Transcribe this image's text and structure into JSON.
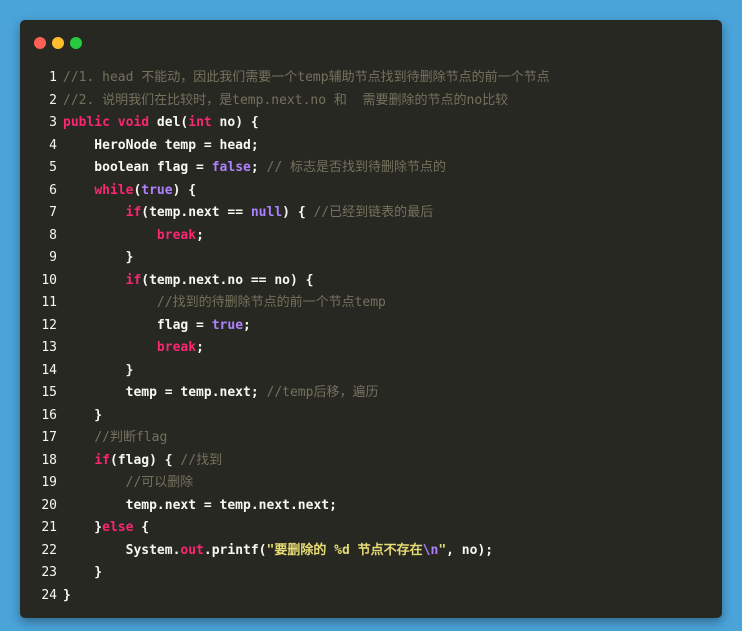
{
  "window": {
    "controls": [
      "close",
      "minimize",
      "maximize"
    ],
    "colors": {
      "close": "#ff5f56",
      "minimize": "#ffbd2e",
      "maximize": "#27c93f",
      "background": "#272822"
    }
  },
  "code_lines": [
    {
      "num": "1",
      "segs": [
        [
          "c-com",
          "//1. head 不能动，因此我们需要一个temp辅助节点找到待删除节点的前一个节点"
        ]
      ]
    },
    {
      "num": "2",
      "segs": [
        [
          "c-com",
          "//2. 说明我们在比较时，是temp.next.no 和  需要删除的节点的no比较"
        ]
      ]
    },
    {
      "num": "3",
      "segs": [
        [
          "c-kw",
          "public"
        ],
        [
          "",
          " "
        ],
        [
          "c-kw",
          "void"
        ],
        [
          "",
          " del("
        ],
        [
          "c-kw",
          "int"
        ],
        [
          "",
          " no) {"
        ]
      ]
    },
    {
      "num": "4",
      "segs": [
        [
          "",
          "    HeroNode temp = head;"
        ]
      ]
    },
    {
      "num": "5",
      "segs": [
        [
          "",
          "    boolean flag = "
        ],
        [
          "c-const",
          "false"
        ],
        [
          "",
          "; "
        ],
        [
          "c-com",
          "// 标志是否找到待删除节点的"
        ]
      ]
    },
    {
      "num": "6",
      "segs": [
        [
          "",
          "    "
        ],
        [
          "c-kw",
          "while"
        ],
        [
          "",
          "("
        ],
        [
          "c-const",
          "true"
        ],
        [
          "",
          ") {"
        ]
      ]
    },
    {
      "num": "7",
      "segs": [
        [
          "",
          "        "
        ],
        [
          "c-kw",
          "if"
        ],
        [
          "",
          "(temp.next == "
        ],
        [
          "c-const",
          "null"
        ],
        [
          "",
          ") { "
        ],
        [
          "c-com",
          "//已经到链表的最后"
        ]
      ]
    },
    {
      "num": "8",
      "segs": [
        [
          "",
          "            "
        ],
        [
          "c-kw",
          "break"
        ],
        [
          "",
          ";"
        ]
      ]
    },
    {
      "num": "9",
      "segs": [
        [
          "",
          "        }"
        ]
      ]
    },
    {
      "num": "10",
      "segs": [
        [
          "",
          "        "
        ],
        [
          "c-kw",
          "if"
        ],
        [
          "",
          "(temp.next.no == no) {"
        ]
      ]
    },
    {
      "num": "11",
      "segs": [
        [
          "",
          "            "
        ],
        [
          "c-com",
          "//找到的待删除节点的前一个节点temp"
        ]
      ]
    },
    {
      "num": "12",
      "segs": [
        [
          "",
          "            flag = "
        ],
        [
          "c-const",
          "true"
        ],
        [
          "",
          ";"
        ]
      ]
    },
    {
      "num": "13",
      "segs": [
        [
          "",
          "            "
        ],
        [
          "c-kw",
          "break"
        ],
        [
          "",
          ";"
        ]
      ]
    },
    {
      "num": "14",
      "segs": [
        [
          "",
          "        }"
        ]
      ]
    },
    {
      "num": "15",
      "segs": [
        [
          "",
          "        temp = temp.next; "
        ],
        [
          "c-com",
          "//temp后移，遍历"
        ]
      ]
    },
    {
      "num": "16",
      "segs": [
        [
          "",
          "    }"
        ]
      ]
    },
    {
      "num": "17",
      "segs": [
        [
          "",
          "    "
        ],
        [
          "c-com",
          "//判断flag"
        ]
      ]
    },
    {
      "num": "18",
      "segs": [
        [
          "",
          "    "
        ],
        [
          "c-kw",
          "if"
        ],
        [
          "",
          "(flag) { "
        ],
        [
          "c-com",
          "//找到"
        ]
      ]
    },
    {
      "num": "19",
      "segs": [
        [
          "",
          "        "
        ],
        [
          "c-com",
          "//可以删除"
        ]
      ]
    },
    {
      "num": "20",
      "segs": [
        [
          "",
          "        temp.next = temp.next.next;"
        ]
      ]
    },
    {
      "num": "21",
      "segs": [
        [
          "",
          "    }"
        ],
        [
          "c-kw",
          "else"
        ],
        [
          "",
          " {"
        ]
      ]
    },
    {
      "num": "22",
      "segs": [
        [
          "",
          "        System."
        ],
        [
          "c-kw",
          "out"
        ],
        [
          "",
          ".printf("
        ],
        [
          "c-str",
          "\"要删除的 %d 节点不存在"
        ],
        [
          "c-esc",
          "\\n"
        ],
        [
          "c-str",
          "\""
        ],
        [
          "",
          ", no);"
        ]
      ]
    },
    {
      "num": "23",
      "segs": [
        [
          "",
          "    }"
        ]
      ]
    },
    {
      "num": "24",
      "segs": [
        [
          "",
          "}"
        ]
      ]
    }
  ]
}
